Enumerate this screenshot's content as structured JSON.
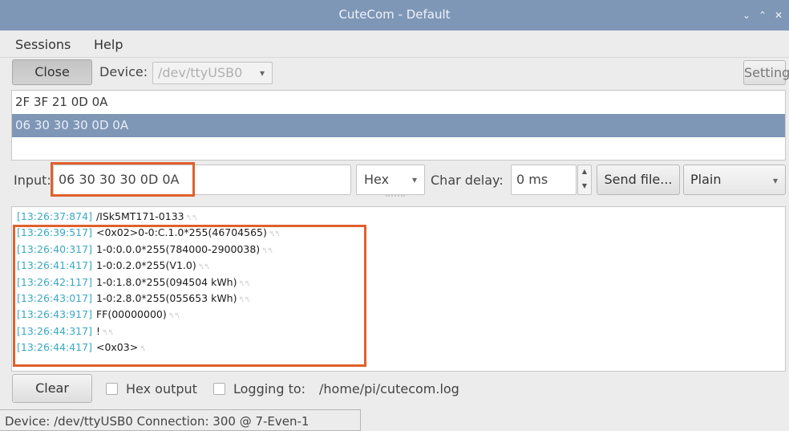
{
  "window": {
    "title": "CuteCom - Default",
    "controls": [
      "⌄",
      "⌃",
      "✕"
    ]
  },
  "menu": {
    "sessions": "Sessions",
    "help": "Help"
  },
  "toolbar": {
    "close_label": "Close",
    "device_label": "Device:",
    "device_value": "/dev/ttyUSB0",
    "settings_label": "Settings"
  },
  "history": [
    "2F 3F 21 0D 0A",
    "06 30 30 30 0D 0A"
  ],
  "input_row": {
    "label": "Input:",
    "value": "06 30 30 30 0D 0A",
    "format": "Hex",
    "char_delay_label": "Char delay:",
    "char_delay_value": "0 ms",
    "send_file_label": "Send file...",
    "line_end": "Plain"
  },
  "output": [
    {
      "time": "[13:26:37:874]",
      "text": "/ISk5MT171-0133",
      "eol": "␤␤"
    },
    {
      "time": "[13:26:39:517]",
      "text": "<0x02>0-0:C.1.0*255(46704565)",
      "eol": "␤␤"
    },
    {
      "time": "[13:26:40:317]",
      "text": "1-0:0.0.0*255(784000-2900038)",
      "eol": "␤␤"
    },
    {
      "time": "[13:26:41:417]",
      "text": "1-0:0.2.0*255(V1.0)",
      "eol": "␤␤"
    },
    {
      "time": "[13:26:42:117]",
      "text": "1-0:1.8.0*255(094504 kWh)",
      "eol": "␤␤"
    },
    {
      "time": "[13:26:43:017]",
      "text": "1-0:2.8.0*255(055653 kWh)",
      "eol": "␤␤"
    },
    {
      "time": "[13:26:43:917]",
      "text": "FF(00000000)",
      "eol": "␤␤"
    },
    {
      "time": "[13:26:44:317]",
      "text": "!",
      "eol": "␤␤"
    },
    {
      "time": "[13:26:44:417]",
      "text": "<0x03>",
      "eol": "␤"
    }
  ],
  "bottom": {
    "clear_label": "Clear",
    "hex_output_label": "Hex output",
    "logging_label": "Logging to:",
    "log_path": "/home/pi/cutecom.log"
  },
  "status": "Device: /dev/ttyUSB0  Connection: 300 @ 7-Even-1",
  "colors": {
    "titlebar": "#7f97b7",
    "highlight": "#e0602c",
    "timestamp": "#3aa7c5"
  }
}
